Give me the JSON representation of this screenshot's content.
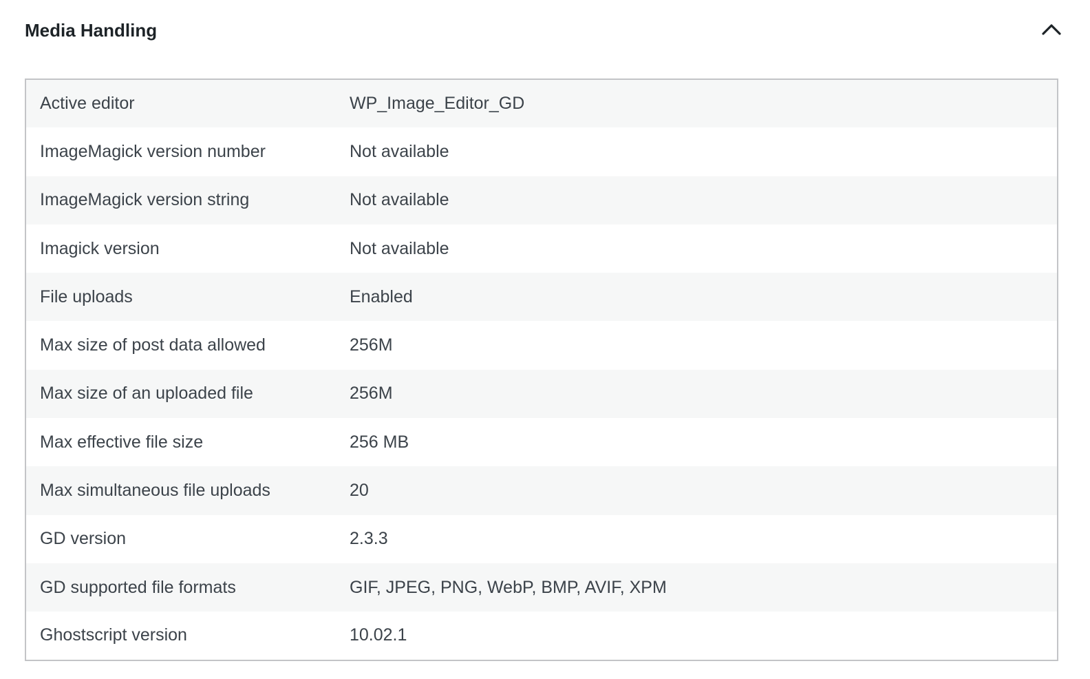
{
  "section": {
    "title": "Media Handling",
    "toggle_icon": "chevron-up-icon"
  },
  "rows": [
    {
      "label": "Active editor",
      "value": "WP_Image_Editor_GD"
    },
    {
      "label": "ImageMagick version number",
      "value": "Not available"
    },
    {
      "label": "ImageMagick version string",
      "value": "Not available"
    },
    {
      "label": "Imagick version",
      "value": "Not available"
    },
    {
      "label": "File uploads",
      "value": "Enabled"
    },
    {
      "label": "Max size of post data allowed",
      "value": "256M"
    },
    {
      "label": "Max size of an uploaded file",
      "value": "256M"
    },
    {
      "label": "Max effective file size",
      "value": "256 MB"
    },
    {
      "label": "Max simultaneous file uploads",
      "value": "20"
    },
    {
      "label": "GD version",
      "value": "2.3.3"
    },
    {
      "label": "GD supported file formats",
      "value": "GIF, JPEG, PNG, WebP, BMP, AVIF, XPM"
    },
    {
      "label": "Ghostscript version",
      "value": "10.02.1"
    }
  ],
  "colors": {
    "title": "#1d2327",
    "text": "#3c434a",
    "row_alt": "#f6f7f7",
    "border": "#c3c4c7"
  }
}
